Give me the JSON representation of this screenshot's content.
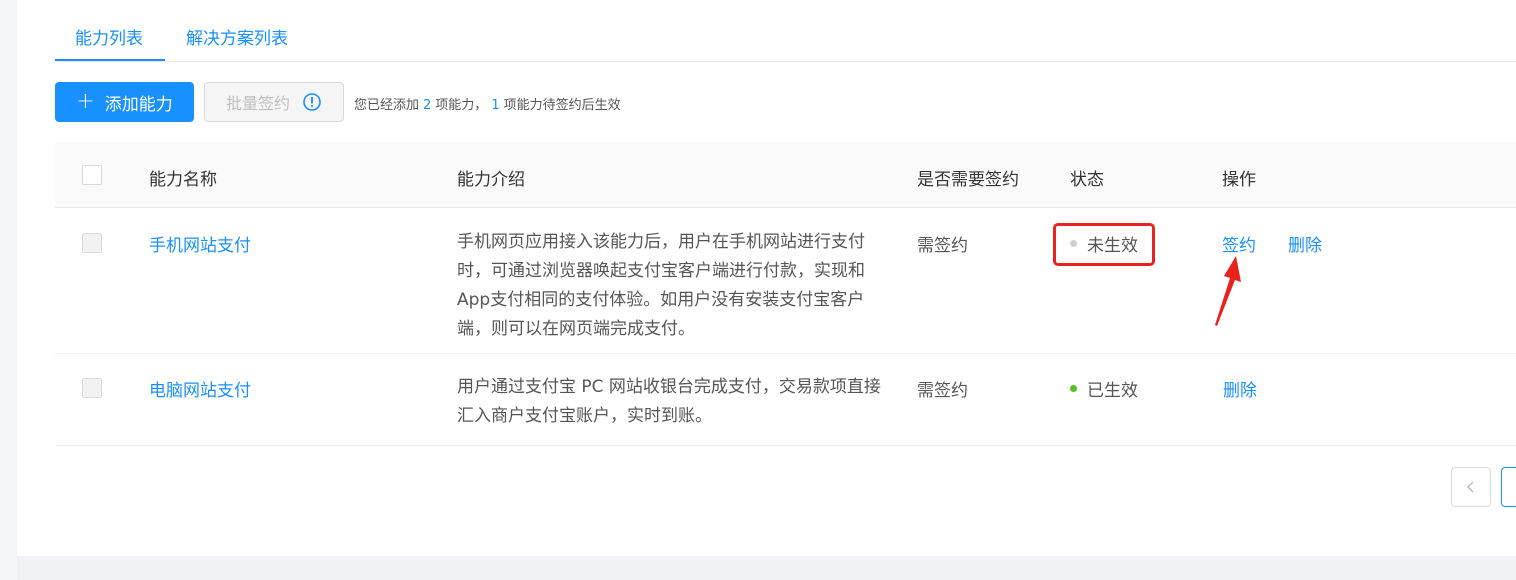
{
  "tabs": [
    {
      "label": "能力列表",
      "active": true
    },
    {
      "label": "解决方案列表",
      "active": false
    }
  ],
  "toolbar": {
    "add_label": "添加能力",
    "batch_sign_label": "批量签约",
    "tip_prefix": "您已经添加",
    "tip_count_added": "2",
    "tip_middle": "项能力，",
    "tip_count_pending": "1",
    "tip_suffix": "项能力待签约后生效"
  },
  "table": {
    "columns": [
      "能力名称",
      "能力介绍",
      "是否需要签约",
      "状态",
      "操作"
    ],
    "rows": [
      {
        "name": "手机网站支付",
        "description": "手机网页应用接入该能力后，用户在手机网站进行支付时，可通过浏览器唤起支付宝客户端进行付款，实现和App支付相同的支付体验。如用户没有安装支付宝客户端，则可以在网页端完成支付。",
        "need_sign": "需签约",
        "status": "未生效",
        "status_color": "#d0d0d0",
        "actions": [
          "签约",
          "删除"
        ]
      },
      {
        "name": "电脑网站支付",
        "description": "用户通过支付宝 PC 网站收银台完成支付，交易款项直接汇入商户支付宝账户，实时到账。",
        "need_sign": "需签约",
        "status": "已生效",
        "status_color": "#52c41a",
        "actions": [
          "删除"
        ]
      }
    ]
  },
  "pagination": {
    "prev_icon": "chevron-left-icon"
  },
  "colors": {
    "primary": "#1890ff",
    "annotation": "#e8231f",
    "success": "#52c41a"
  }
}
